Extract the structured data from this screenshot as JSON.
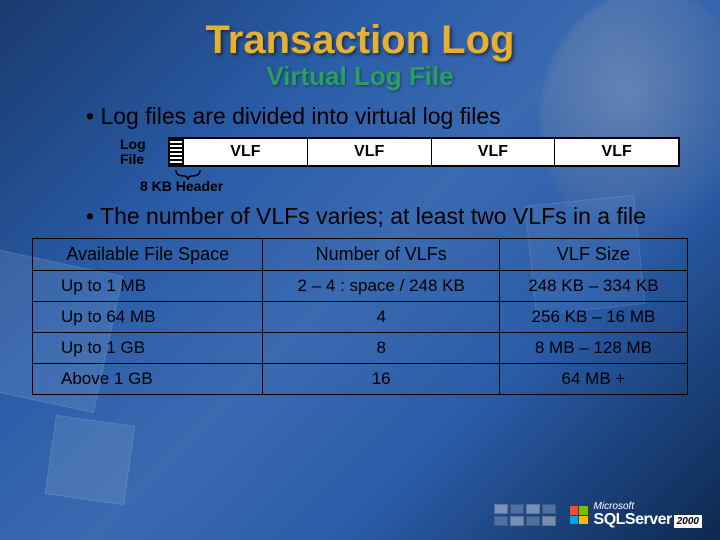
{
  "title": "Transaction Log",
  "subtitle": "Virtual Log File",
  "bullets": {
    "b1": "Log files are divided into virtual log files",
    "b2": "The number of VLFs varies; at least two VLFs in a file"
  },
  "logfile": {
    "label": "Log\nFile",
    "segments": [
      "VLF",
      "VLF",
      "VLF",
      "VLF"
    ],
    "header_caption": "8 KB Header"
  },
  "table": {
    "headers": [
      "Available File Space",
      "Number of VLFs",
      "VLF Size"
    ],
    "rows": [
      [
        "Up to 1 MB",
        "2 – 4 : space / 248 KB",
        "248 KB – 334  KB"
      ],
      [
        "Up to 64 MB",
        "4",
        "256 KB – 16 MB"
      ],
      [
        "Up to 1 GB",
        "8",
        "8 MB – 128 MB"
      ],
      [
        "Above 1 GB",
        "16",
        "64 MB +"
      ]
    ]
  },
  "footer": {
    "brand_small": "Microsoft",
    "brand_big": "SQLServer",
    "year": "2000"
  }
}
